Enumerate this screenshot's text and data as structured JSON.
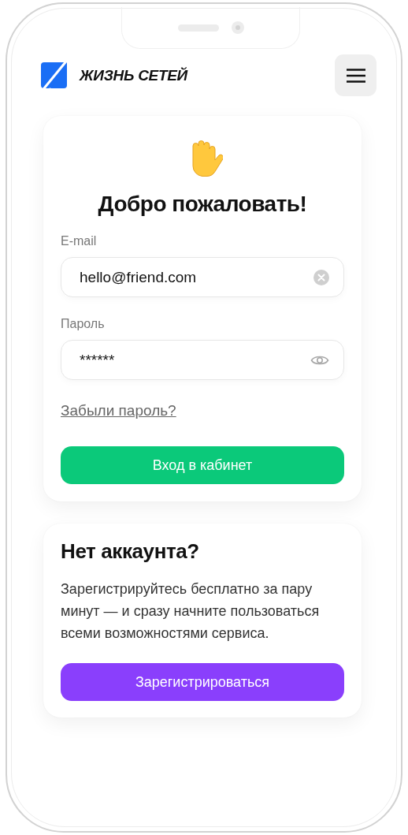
{
  "header": {
    "brand": "ЖИЗНЬ СЕТЕЙ"
  },
  "login": {
    "title": "Добро пожаловать!",
    "fields": [
      {
        "label": "E-mail",
        "value": "hello@friend.com",
        "kind": "clear"
      },
      {
        "label": "Пароль",
        "value": "******",
        "kind": "reveal"
      }
    ],
    "forgot_link": "Забыли пароль?",
    "submit": "Вход в кабинет"
  },
  "signup": {
    "title": "Нет аккаунта?",
    "text": "Зарегистрируйтесь бесплатно за пару минут — и сразу начните пользоваться всеми возможностями сервиса.",
    "button": "Зарегистрироваться"
  }
}
